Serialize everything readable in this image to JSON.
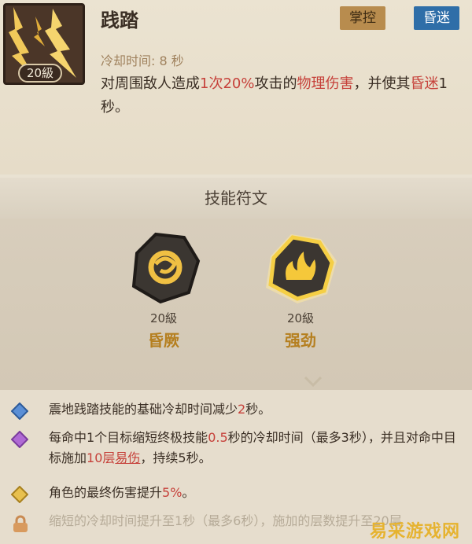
{
  "skill": {
    "name": "践踏",
    "level": "20級",
    "tags": [
      "掌控",
      "昏迷"
    ],
    "cooldown": "冷却时间: 8 秒",
    "description_parts": [
      "对周围敌人造成",
      "1次",
      "20%",
      "攻击的",
      "物理伤害",
      "，并使其",
      "昏迷",
      "1秒。"
    ]
  },
  "runes": {
    "header": "技能符文",
    "items": [
      {
        "level": "20級",
        "name": "昏厥",
        "icon": "swirl-rune-icon"
      },
      {
        "level": "20級",
        "name": "强劲",
        "icon": "flame-rune-icon"
      }
    ]
  },
  "effects": [
    {
      "gem": "blue-diamond-icon",
      "parts": [
        "震地践踏技能的基础冷却时间减少",
        "2",
        "秒。"
      ]
    },
    {
      "gem": "purple-diamond-icon",
      "parts": [
        "每命中1个目标缩短终极技能",
        "0.5",
        "秒的冷却时间（最多3秒），并且对命中目标施加",
        "10层",
        "易伤",
        "，持续5秒。"
      ]
    },
    {
      "gem": "gold-diamond-icon",
      "parts": [
        "角色的最终伤害提升",
        "5%",
        "。"
      ]
    },
    {
      "gem": "lock-icon",
      "parts": [
        "缩短的冷却时间提升至1秒（最多6秒），施加的层数提升至20层"
      ]
    }
  ],
  "watermark": "易采游戏网",
  "colors": {
    "highlight": "#c6413a",
    "rune_name": "#b57f1f",
    "tag_control": "#b88c4e",
    "tag_stun": "#2f6ea8"
  }
}
